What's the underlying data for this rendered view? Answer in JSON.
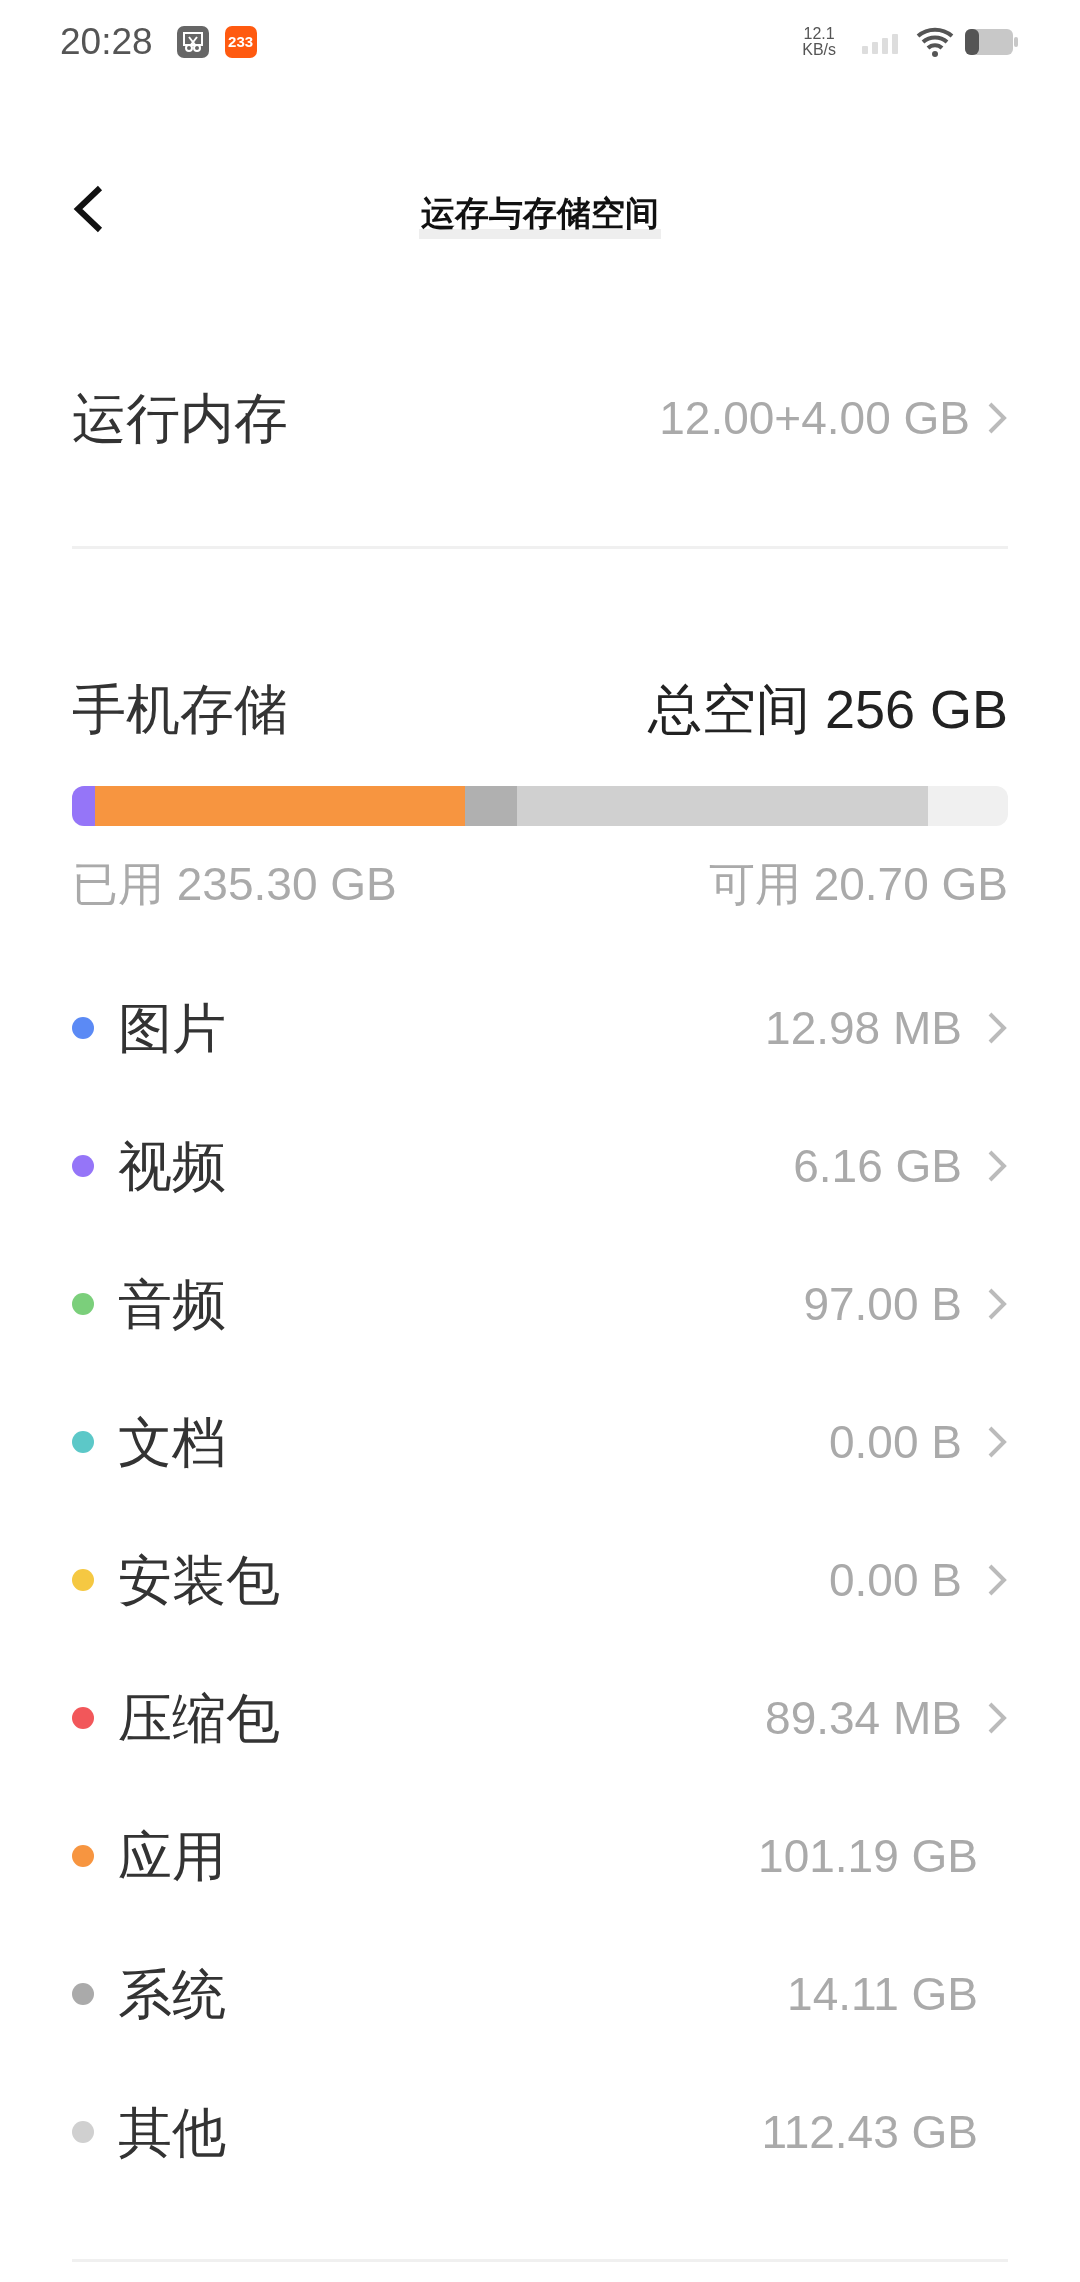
{
  "status_bar": {
    "time": "20:28",
    "app_badge": "233",
    "net_speed": "12.1",
    "net_unit": "KB/s"
  },
  "header": {
    "title": "运存与存储空间"
  },
  "ram": {
    "label": "运行内存",
    "value": "12.00+4.00 GB"
  },
  "storage": {
    "label": "手机存储",
    "total": "总空间 256 GB",
    "used": "已用 235.30 GB",
    "free": "可用 20.70 GB",
    "bar_segments": [
      {
        "color": "#9575f8"
      },
      {
        "color": "#f79540"
      },
      {
        "color": "#b0b0b0"
      },
      {
        "color": "#d0d0d0"
      }
    ]
  },
  "categories": [
    {
      "label": "图片",
      "value": "12.98 MB",
      "color": "#5b8af5",
      "chevron": true
    },
    {
      "label": "视频",
      "value": "6.16 GB",
      "color": "#9575f8",
      "chevron": true
    },
    {
      "label": "音频",
      "value": "97.00 B",
      "color": "#7bcf7b",
      "chevron": true
    },
    {
      "label": "文档",
      "value": "0.00 B",
      "color": "#5cc8c8",
      "chevron": true
    },
    {
      "label": "安装包",
      "value": "0.00 B",
      "color": "#f5c842",
      "chevron": true
    },
    {
      "label": "压缩包",
      "value": "89.34 MB",
      "color": "#f2575a",
      "chevron": true
    },
    {
      "label": "应用",
      "value": "101.19 GB",
      "color": "#f79540",
      "chevron": false
    },
    {
      "label": "系统",
      "value": "14.11 GB",
      "color": "#aaaaaa",
      "chevron": false
    },
    {
      "label": "其他",
      "value": "112.43 GB",
      "color": "#d0d0d0",
      "chevron": false
    }
  ]
}
